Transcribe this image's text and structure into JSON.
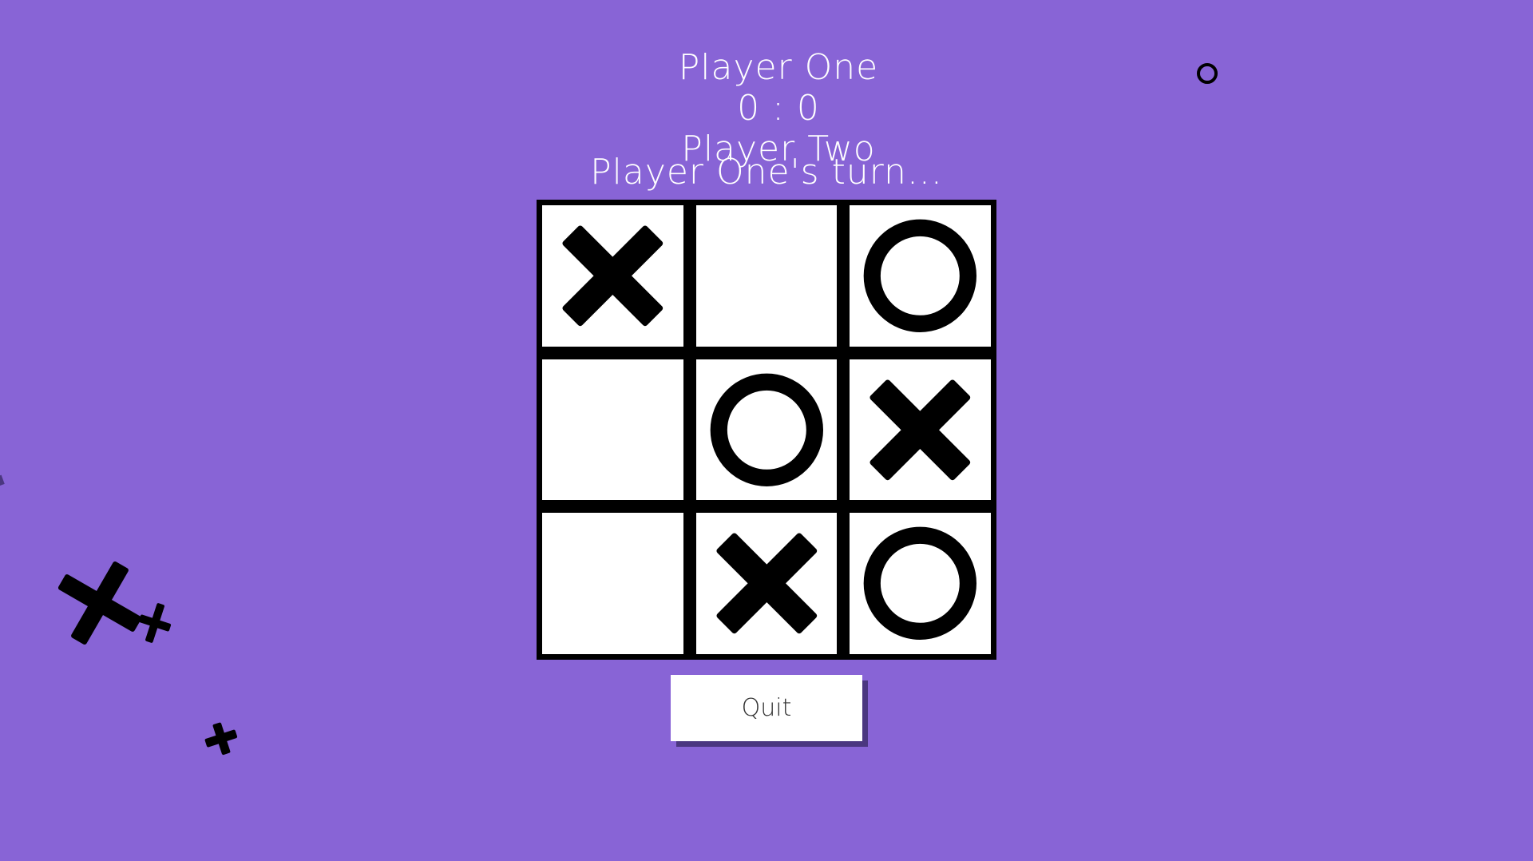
{
  "scoreboard": {
    "player_one": "Player One",
    "score": "0 : 0",
    "player_two": "Player Two"
  },
  "status": "Player One's turn...",
  "board": [
    [
      "X",
      "",
      "O"
    ],
    [
      "",
      "O",
      "X"
    ],
    [
      "",
      "X",
      "O"
    ]
  ],
  "buttons": {
    "quit": "Quit"
  },
  "colors": {
    "background": "#8864d6",
    "mark": "#000000",
    "cell": "#ffffff",
    "button_shadow": "#4b3780"
  }
}
